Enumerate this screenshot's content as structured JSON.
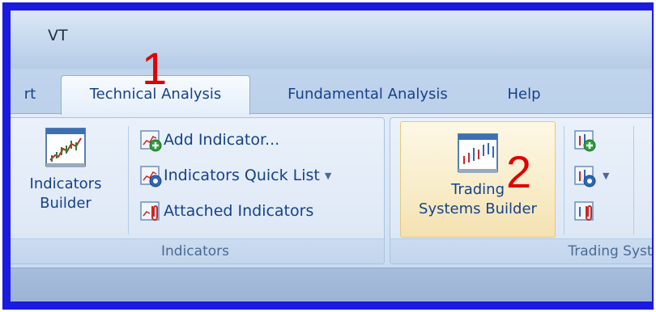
{
  "window": {
    "title": "VT"
  },
  "tabs": [
    {
      "label": "rt"
    },
    {
      "label": "Technical Analysis"
    },
    {
      "label": "Fundamental Analysis"
    },
    {
      "label": "Help"
    }
  ],
  "ribbon": {
    "indicators_group": {
      "label": "Indicators",
      "builder_line1": "Indicators",
      "builder_line2": "Builder",
      "add_indicator": "Add Indicator...",
      "quick_list": "Indicators Quick List",
      "attached": "Attached Indicators"
    },
    "trading_group": {
      "label": "Trading Syste",
      "builder_line1": "Trading",
      "builder_line2": "Systems Builder"
    }
  },
  "annotations": {
    "one": "1",
    "two": "2"
  },
  "colors": {
    "frame": "#1a1ae0",
    "annotation": "#e00000",
    "ribbon_text": "#15428b"
  },
  "icons": [
    "chart-builder-icon",
    "add-indicator-icon",
    "quick-list-icon",
    "attached-indicators-icon",
    "trading-systems-builder-icon",
    "add-system-icon",
    "system-list-icon",
    "attached-systems-icon"
  ]
}
